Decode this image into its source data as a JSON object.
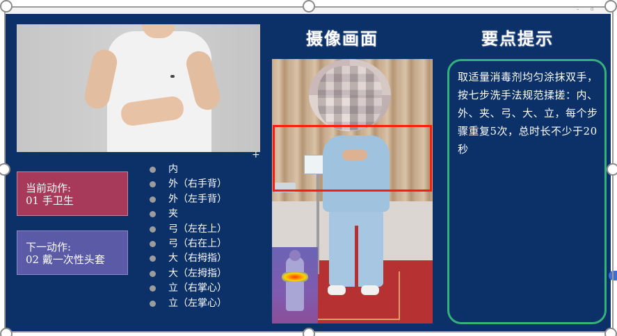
{
  "window": {
    "minimize_glyph": "–",
    "restore_glyph": "▫"
  },
  "current_action": {
    "label": "当前动作:",
    "value": "01 手卫生"
  },
  "next_action": {
    "label": "下一动作:",
    "value": "02 戴一次性头套"
  },
  "steps": [
    "内",
    "外（右手背）",
    "外（左手背）",
    "夹",
    "弓（左在上）",
    "弓（右在上）",
    "大（右拇指）",
    "大（左拇指）",
    "立（右掌心）",
    "立（左掌心）"
  ],
  "headings": {
    "camera": "摄像画面",
    "tips": "要点提示"
  },
  "tips": {
    "text": "取适量消毒剂均匀涂抹双手，按七步洗手法规范揉搓：内、外、夹、弓、大、立，每个步骤重复5次，总时长不少于20秒"
  },
  "colors": {
    "panel_bg": "#0b3168",
    "current_box": "#a73a5b",
    "next_box": "#5a5aa6",
    "detection_box": "#ff1a0a",
    "tips_border": "#33b37a"
  },
  "icons": {
    "cross": "crosshair-icon",
    "side_tab": "chevron-left-icon"
  }
}
